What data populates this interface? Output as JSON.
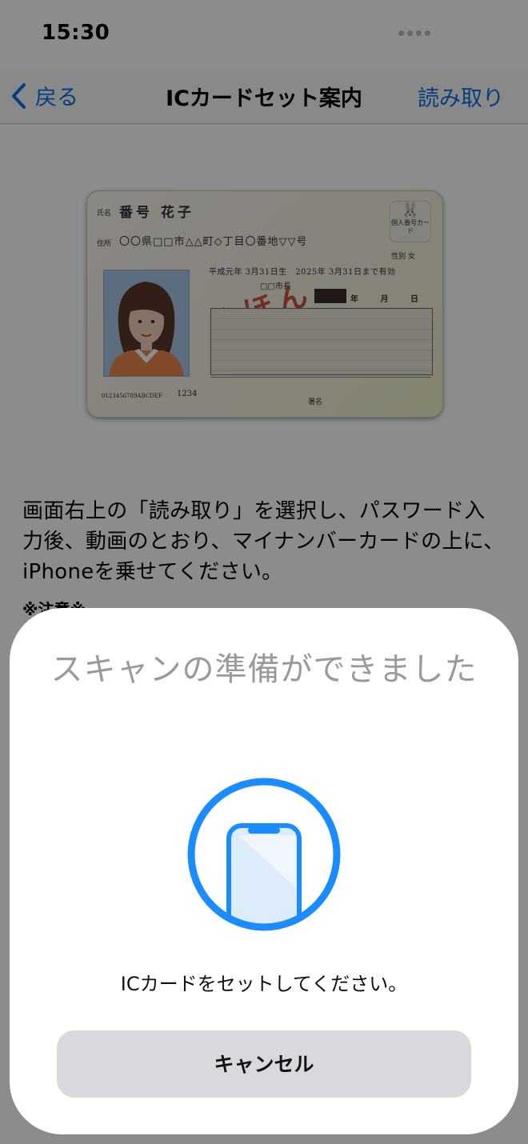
{
  "status_bar": {
    "time": "15:30"
  },
  "nav": {
    "back_label": "戻る",
    "title": "ICカードセット案内",
    "action_label": "読み取り"
  },
  "card": {
    "name_label": "氏名",
    "name": "番号 花子",
    "address_label": "住所",
    "address": "〇〇県□□市△△町◇丁目〇番地▽▽号",
    "badge": "個人番号カード",
    "sex": "性別 女",
    "dates": "平成元年 3月31日生　2025年 3月31日まで有効",
    "city": "□□市長",
    "ymd": "年 月 日",
    "mihon": "みほん",
    "serial": "0123456789ABCDEF",
    "number": "1234",
    "sign_label": "署名"
  },
  "instruction": "画面右上の「読み取り」を選択し、パスワード入力後、動画のとおり、マイナンバーカードの上に、iPhoneを乗せてください。",
  "caution": "※注意※",
  "scan_sheet": {
    "title": "スキャンの準備ができました",
    "message": "ICカードをセットしてください。",
    "cancel_label": "キャンセル"
  },
  "colors": {
    "accent": "#0a72e8",
    "scan_ring": "#1a8cff",
    "cancel_bg": "#d8d8dd"
  }
}
